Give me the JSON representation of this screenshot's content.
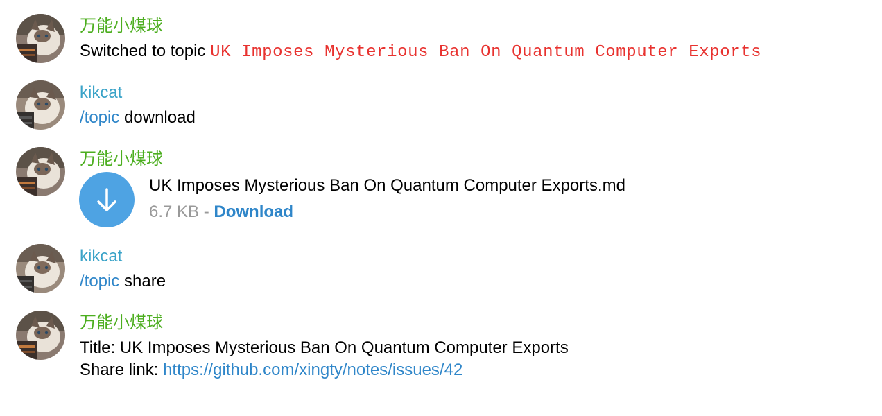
{
  "colors": {
    "sender_bot": "#4cae1f",
    "sender_user": "#3aa3c8",
    "topic_red": "#e8322f",
    "link_blue": "#2f86c9",
    "file_blue": "#4ea3e3",
    "meta_gray": "#999999"
  },
  "messages": [
    {
      "sender": "万能小煤球",
      "prefix": "Switched to topic ",
      "topic": "UK Imposes Mysterious Ban On Quantum Computer Exports"
    },
    {
      "sender": "kikcat",
      "command": "/topic",
      "argument": " download"
    },
    {
      "sender": "万能小煤球",
      "file": {
        "name": "UK Imposes Mysterious Ban On Quantum Computer Exports.md",
        "size": "6.7 KB",
        "separator": " - ",
        "action": "Download",
        "icon": "download-arrow-icon"
      }
    },
    {
      "sender": "kikcat",
      "command": "/topic",
      "argument": " share"
    },
    {
      "sender": "万能小煤球",
      "title_line": "Title: UK Imposes Mysterious Ban On Quantum Computer Exports",
      "share_prefix": "Share link: ",
      "share_url": "https://github.com/xingty/notes/issues/42"
    }
  ]
}
